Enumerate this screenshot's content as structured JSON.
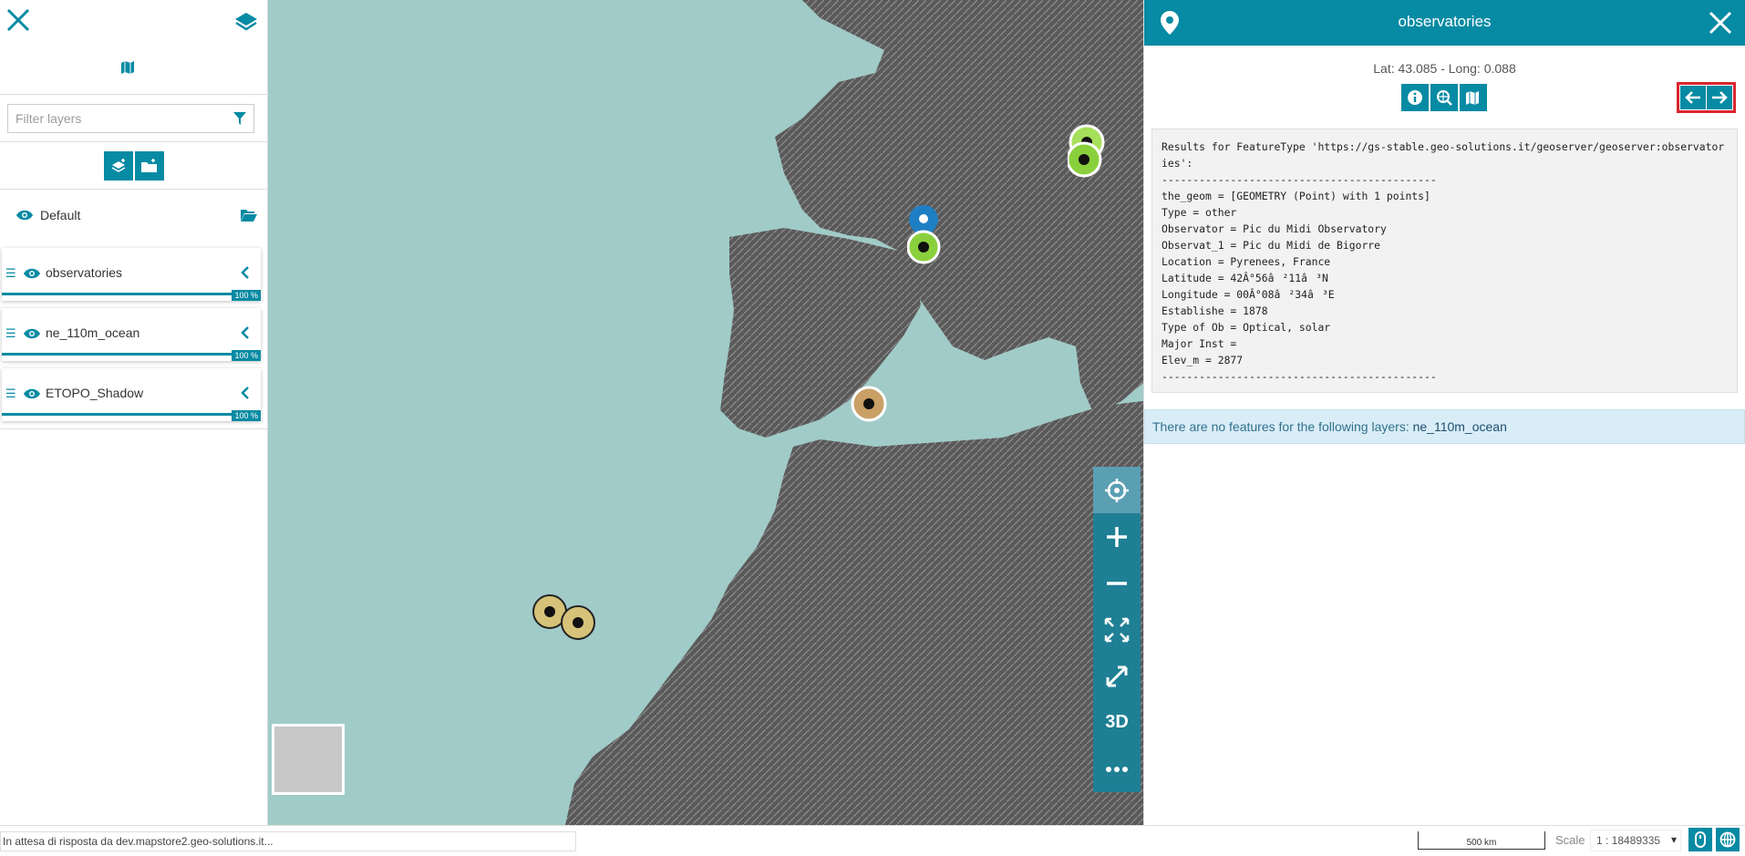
{
  "colors": {
    "accent": "#078aa3",
    "sea": "#a1cbc8",
    "highlight_border": "#d9262e",
    "info_bg": "#d9edf6"
  },
  "toc": {
    "close_icon": "close-icon",
    "layers_icon": "layers-icon",
    "map_icon": "map-icon",
    "filter_placeholder": "Filter layers",
    "group": {
      "name": "Default"
    },
    "layers": [
      {
        "name": "observatories",
        "opacity": "100 %"
      },
      {
        "name": "ne_110m_ocean",
        "opacity": "100 %"
      },
      {
        "name": "ETOPO_Shadow",
        "opacity": "100 %"
      }
    ]
  },
  "identify": {
    "title": "observatories",
    "coords": "Lat: 43.085 - Long: 0.088",
    "results_text": "Results for FeatureType 'https://gs-stable.geo-solutions.it/geoserver/geoserver:observatories':\n--------------------------------------------\nthe_geom = [GEOMETRY (Point) with 1 points]\nType = other\nObservator = Pic du Midi Observatory\nObservat_1 = Pic du Midi de Bigorre\nLocation = Pyrenees, France\nLatitude = 42Â°56â²11â³N\nLongitude = 00Â°08â²34â³E\nEstablishe = 1878\nType of Ob = Optical, solar\nMajor Inst = \nElev_m = 2877\n--------------------------------------------",
    "no_features_text": "There are no features for the following layers: ",
    "no_features_layer": "ne_110m_ocean"
  },
  "map_tools": {
    "three_d_label": "3D"
  },
  "footer": {
    "status": "In attesa di risposta da dev.mapstore2.geo-solutions.it...",
    "scalebar_label": "500 km",
    "scale_label": "Scale",
    "scale_value": "1 : 18489335"
  }
}
